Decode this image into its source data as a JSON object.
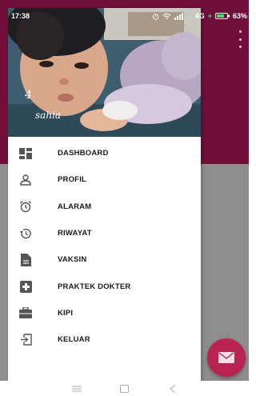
{
  "status_bar": {
    "time": "17:38",
    "network": "4G",
    "battery_percent": "63%"
  },
  "drawer": {
    "header": {
      "number": "4",
      "name": "sahia"
    },
    "menu": [
      {
        "label": "DASHBOARD",
        "icon": "dashboard-icon"
      },
      {
        "label": "PROFIL",
        "icon": "person-icon"
      },
      {
        "label": "ALARAM",
        "icon": "alarm-clock-icon"
      },
      {
        "label": "RIWAYAT",
        "icon": "history-icon"
      },
      {
        "label": "VAKSIN",
        "icon": "document-icon"
      },
      {
        "label": "PRAKTEK DOKTER",
        "icon": "medical-cross-icon"
      },
      {
        "label": "KIPI",
        "icon": "briefcase-icon"
      },
      {
        "label": "KELUAR",
        "icon": "logout-icon"
      }
    ]
  },
  "colors": {
    "toolbar": "#6f0f3a",
    "fab": "#b8234f",
    "scrim": "#8e8e8e"
  }
}
